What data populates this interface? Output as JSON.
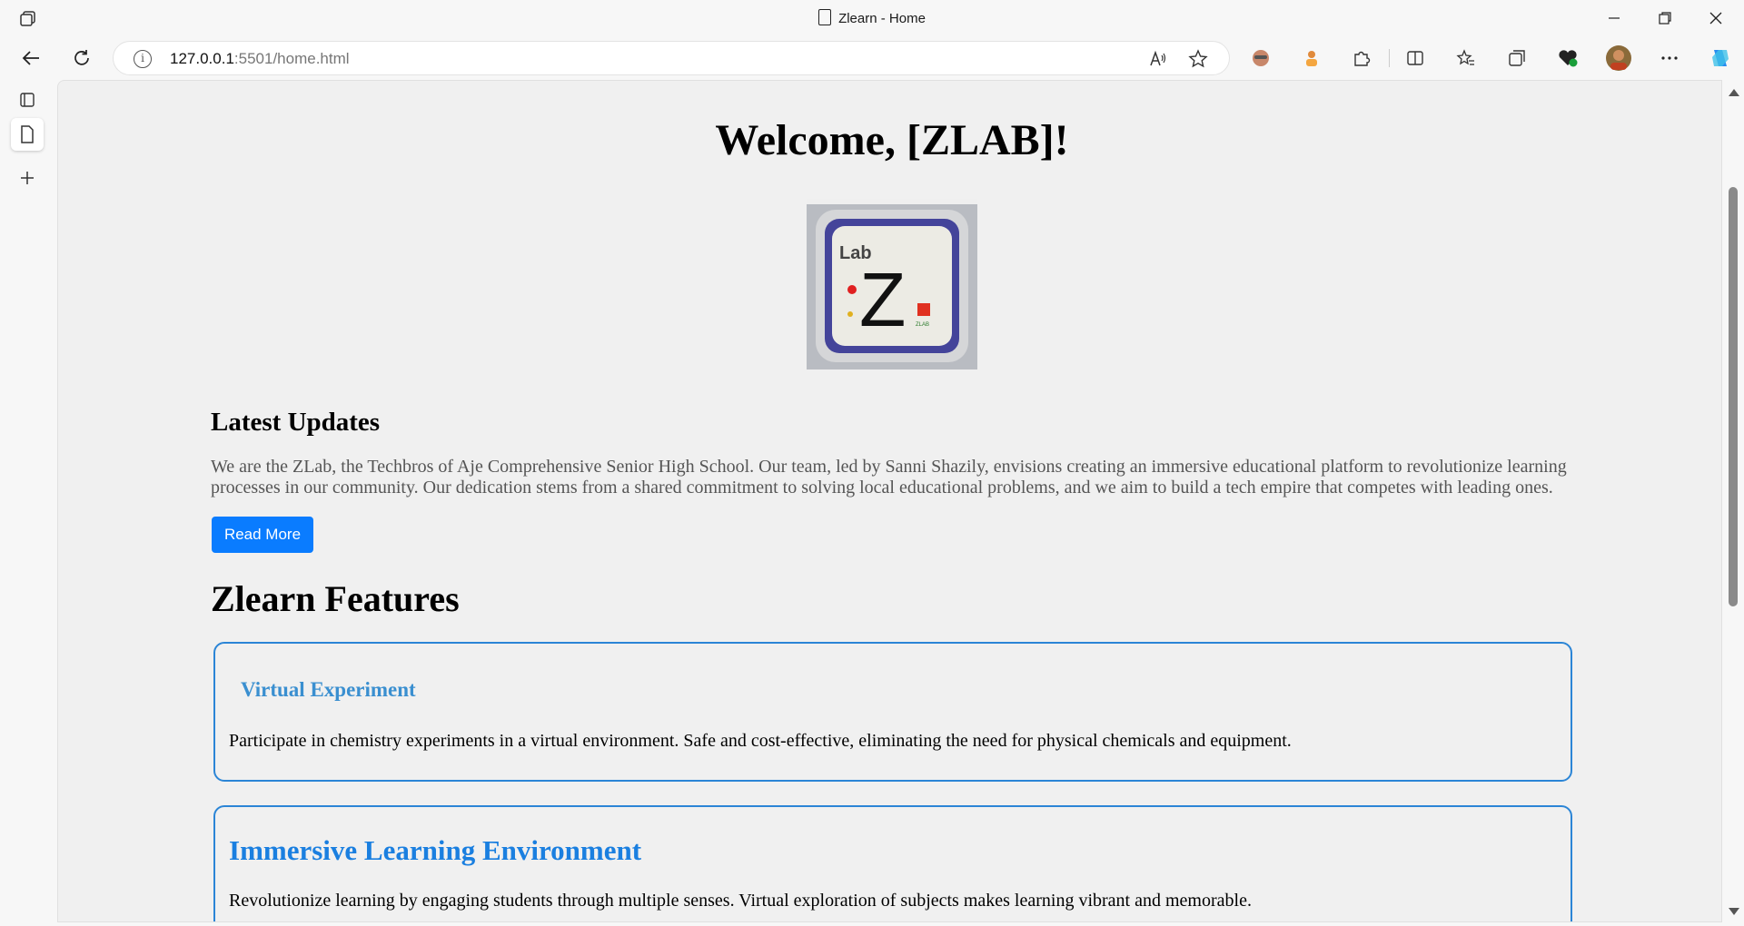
{
  "window": {
    "title": "Zlearn - Home"
  },
  "addressbar": {
    "host": "127.0.0.1",
    "path": ":5501/home.html"
  },
  "page": {
    "welcome": "Welcome, [ZLAB]!",
    "logo_text_top": "Lab",
    "logo_letter": "Z",
    "logo_text_small": "ZLAB",
    "updates_heading": "Latest Updates",
    "updates_text": "We are the ZLab, the Techbros of Aje Comprehensive Senior High School. Our team, led by Sanni Shazily, envisions creating an immersive educational platform to revolutionize learning processes in our community. Our dedication stems from a shared commitment to solving local educational problems, and we aim to build a tech empire that competes with leading ones.",
    "read_more_label": "Read More",
    "features_heading": "Zlearn Features",
    "features": [
      {
        "title": "Virtual Experiment",
        "description": "Participate in chemistry experiments in a virtual environment. Safe and cost-effective, eliminating the need for physical chemicals and equipment."
      },
      {
        "title": "Immersive Learning Environment",
        "description": "Revolutionize learning by engaging students through multiple senses. Virtual exploration of subjects makes learning vibrant and memorable."
      }
    ]
  },
  "colors": {
    "accent_button": "#0a7cff",
    "card_border": "#2b85d6",
    "feature_title": "#1a7fe0"
  },
  "icons": {
    "titlebar": "tab-actions-icon",
    "back": "back-arrow-icon",
    "reload": "reload-icon",
    "info": "site-info-icon",
    "read_aloud": "read-aloud-icon",
    "favorite": "star-icon"
  }
}
